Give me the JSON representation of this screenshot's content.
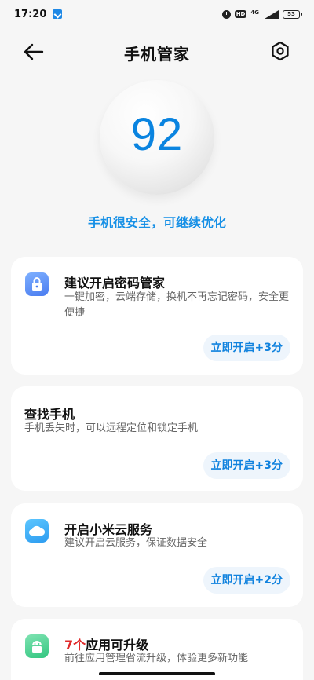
{
  "status_bar": {
    "time": "17:20",
    "hd": "HD",
    "network": "4G",
    "battery": "53"
  },
  "header": {
    "title": "手机管家"
  },
  "score": {
    "value": "92",
    "status": "手机很安全，可继续优化",
    "color": "#0a84e0"
  },
  "cards": [
    {
      "title": "建议开启密码管家",
      "description": "一键加密，云端存储，换机不再忘记密码，安全更便捷",
      "action": "立即开启+3分",
      "icon": "lock-icon"
    },
    {
      "title": "查找手机",
      "description": "手机丢失时，可以远程定位和锁定手机",
      "action": "立即开启+3分"
    },
    {
      "title": "开启小米云服务",
      "description": "建议开启云服务，保证数据安全",
      "action": "立即开启+2分",
      "icon": "cloud-icon"
    },
    {
      "title_count": "7个",
      "title_rest": "应用可升级",
      "description": "前往应用管理省流升级，体验更多新功能",
      "icon": "android-app-icon"
    }
  ],
  "colors": {
    "accent": "#1082de",
    "highlight": "#e02a2a",
    "background": "#f6f6f6"
  }
}
